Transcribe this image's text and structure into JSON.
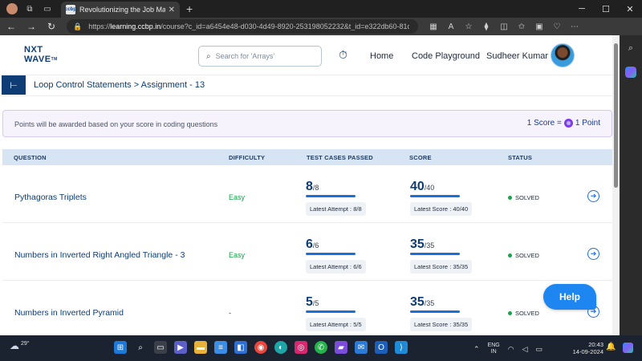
{
  "browser": {
    "tab_title": "Revolutionizing the Job Market | N",
    "tab_favicon_text": "ccbp",
    "url_domain": "learning.ccbp.in",
    "url_rest": "/course?c_id=a6454e48-d030-4d49-8920-253198052232&t_id=e322db60-81d..."
  },
  "header": {
    "logo_line1": "NXT",
    "logo_line2": "WAVE",
    "logo_tm": "TM",
    "search_placeholder": "Search for 'Arrays'",
    "nav_home": "Home",
    "nav_code": "Code Playground",
    "user_name": "Sudheer Kumar"
  },
  "breadcrumb": {
    "text": "Loop Control Statements > Assignment - 13"
  },
  "banner": {
    "left": "Points will be awarded based on your score in coding questions",
    "right_prefix": "1 Score =",
    "right_suffix": "1 Point"
  },
  "table": {
    "headers": {
      "question": "QUESTION",
      "difficulty": "DIFFICULTY",
      "test_cases": "TEST CASES PASSED",
      "score": "SCORE",
      "status": "STATUS"
    },
    "rows": [
      {
        "question": "Pythagoras Triplets",
        "difficulty": "Easy",
        "tc_value": "8",
        "tc_total": "/8",
        "tc_latest": "Latest Attempt : 8/8",
        "score_value": "40",
        "score_total": "/40",
        "score_latest": "Latest Score : 40/40",
        "status": "SOLVED"
      },
      {
        "question": "Numbers in Inverted Right Angled Triangle - 3",
        "difficulty": "Easy",
        "tc_value": "6",
        "tc_total": "/6",
        "tc_latest": "Latest Attempt : 6/6",
        "score_value": "35",
        "score_total": "/35",
        "score_latest": "Latest Score : 35/35",
        "status": "SOLVED"
      },
      {
        "question": "Numbers in Inverted Pyramid",
        "difficulty": "-",
        "tc_value": "5",
        "tc_total": "/5",
        "tc_latest": "Latest Attempt : 5/5",
        "score_value": "35",
        "score_total": "/35",
        "score_latest": "Latest Score : 35/35",
        "status": "SOLVED"
      }
    ]
  },
  "help_label": "Help",
  "taskbar": {
    "temperature": "29°",
    "lang_line1": "ENG",
    "lang_line2": "IN",
    "time": "20:43",
    "date": "14-09-2024"
  },
  "colors": {
    "brand": "#0e3c75",
    "accent": "#1d6fd8",
    "easy": "#16a34a",
    "help": "#1d86f0"
  }
}
